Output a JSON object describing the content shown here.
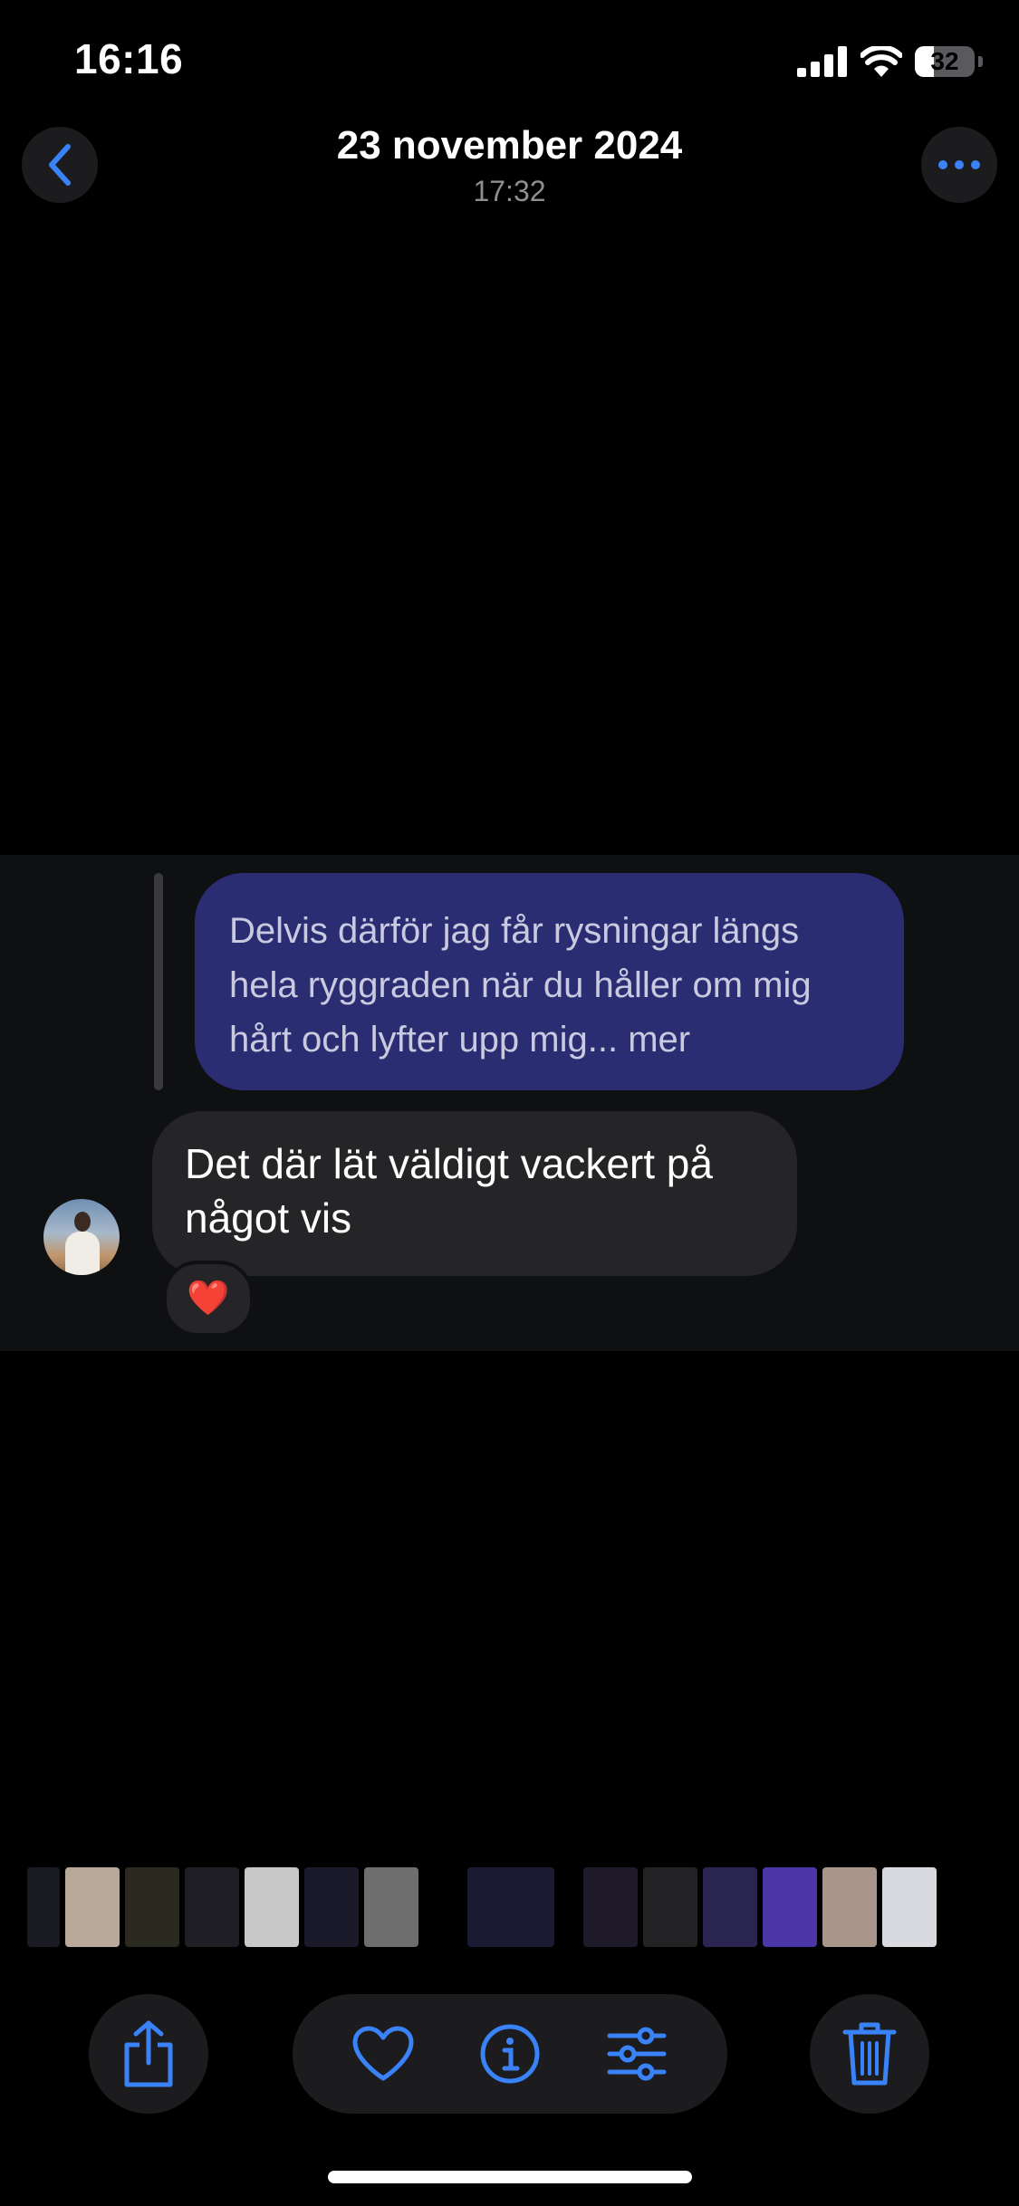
{
  "status_bar": {
    "time": "16:16",
    "battery": {
      "text": "32",
      "level": 0.32
    }
  },
  "header": {
    "title": "23 november 2024",
    "subtitle": "17:32"
  },
  "photo": {
    "outgoing_message": "Delvis därför jag får rysningar längs hela ryggraden när du håller om mig hårt och lyfter upp mig... mer",
    "incoming_message": "Det där lät väldigt vackert på något vis",
    "reaction": "❤️"
  },
  "thumbnails": [
    {
      "name": "thumb-1",
      "color": "#1a1a22"
    },
    {
      "name": "thumb-2",
      "color": "#b9a99a"
    },
    {
      "name": "thumb-3",
      "color": "#2a2a20"
    },
    {
      "name": "thumb-4",
      "color": "#1e1e24"
    },
    {
      "name": "thumb-5",
      "color": "#c8c8c8"
    },
    {
      "name": "thumb-6",
      "color": "#1a1a2a"
    },
    {
      "name": "thumb-7",
      "color": "#6e6e6e"
    },
    {
      "name": "thumb-8-current",
      "color": "#1a1b33"
    },
    {
      "name": "thumb-9",
      "color": "#1e1a2a"
    },
    {
      "name": "thumb-10",
      "color": "#232326"
    },
    {
      "name": "thumb-11",
      "color": "#2a2550"
    },
    {
      "name": "thumb-12",
      "color": "#4b36a8"
    },
    {
      "name": "thumb-13",
      "color": "#a8968a"
    },
    {
      "name": "thumb-14",
      "color": "#d9d9e0"
    }
  ],
  "toolbar": {
    "accent": "#3a82f7",
    "icons": [
      "share-icon",
      "heart-icon",
      "info-icon",
      "adjust-icon",
      "trash-icon"
    ]
  }
}
